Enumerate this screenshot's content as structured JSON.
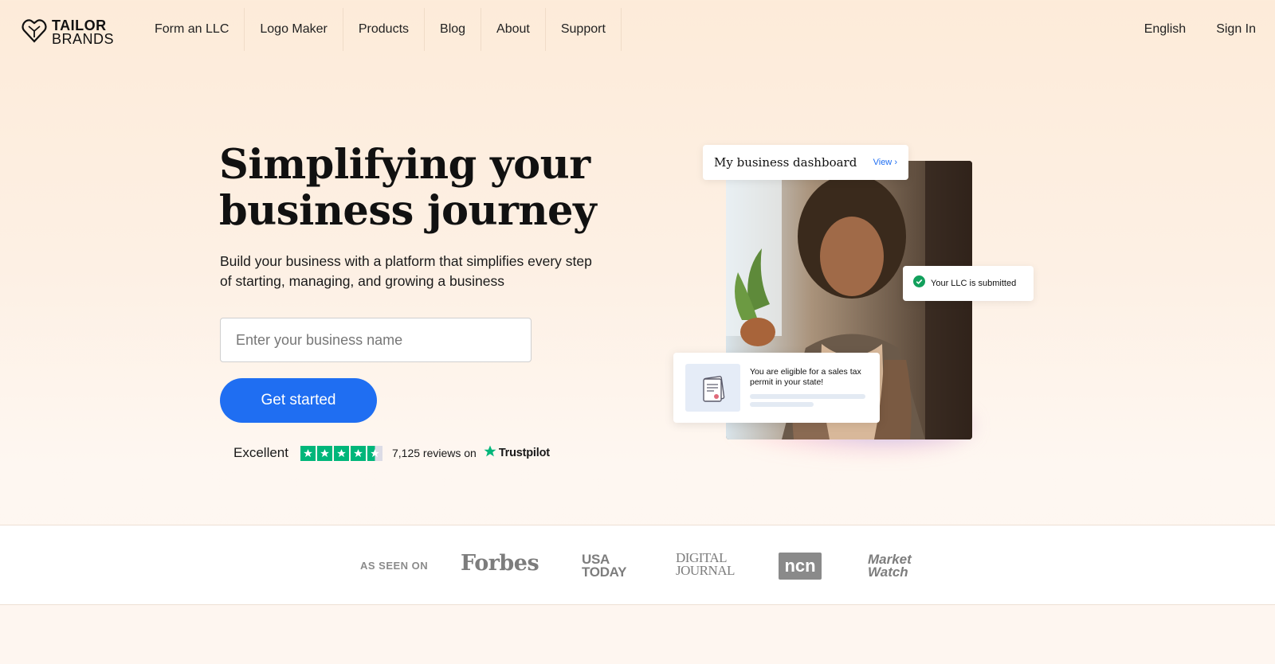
{
  "nav": {
    "logo": {
      "line1": "TAILOR",
      "line2": "BRANDS"
    },
    "links": [
      {
        "label": "Form an LLC"
      },
      {
        "label": "Logo Maker"
      },
      {
        "label": "Products"
      },
      {
        "label": "Blog"
      },
      {
        "label": "About"
      },
      {
        "label": "Support"
      }
    ],
    "language": "English",
    "sign_in": "Sign In"
  },
  "hero": {
    "title_line1": "Simplifying your",
    "title_line2": "business journey",
    "subtitle": "Build your business with a platform that simplifies every step of starting, managing, and growing a business",
    "input_placeholder": "Enter your business name",
    "input_value": "",
    "cta": "Get started"
  },
  "trustpilot": {
    "rating_text": "Excellent",
    "stars": 4.5,
    "reviews": "7,125 reviews on",
    "brand": "Trustpilot",
    "color": "#00b67a"
  },
  "visual": {
    "dashboard_card": {
      "title": "My business dashboard",
      "link": "View"
    },
    "llc_card": {
      "text": "Your LLC is submitted",
      "icon": "check-circle-icon",
      "color": "#12a05c"
    },
    "tax_card": {
      "text": "You are eligible for a sales tax permit in your state!",
      "icon": "certificate-icon"
    }
  },
  "press": {
    "label": "AS SEEN ON",
    "logos": [
      {
        "name": "Forbes"
      },
      {
        "line1": "USA",
        "line2": "TODAY"
      },
      {
        "line1": "DIGITAL",
        "line2": "JOURNAL"
      },
      {
        "name": "ncn"
      },
      {
        "line1": "Market",
        "line2": "Watch"
      }
    ]
  },
  "colors": {
    "accent": "#1f6ef2",
    "background": "#fdebd9",
    "text": "#111111"
  }
}
